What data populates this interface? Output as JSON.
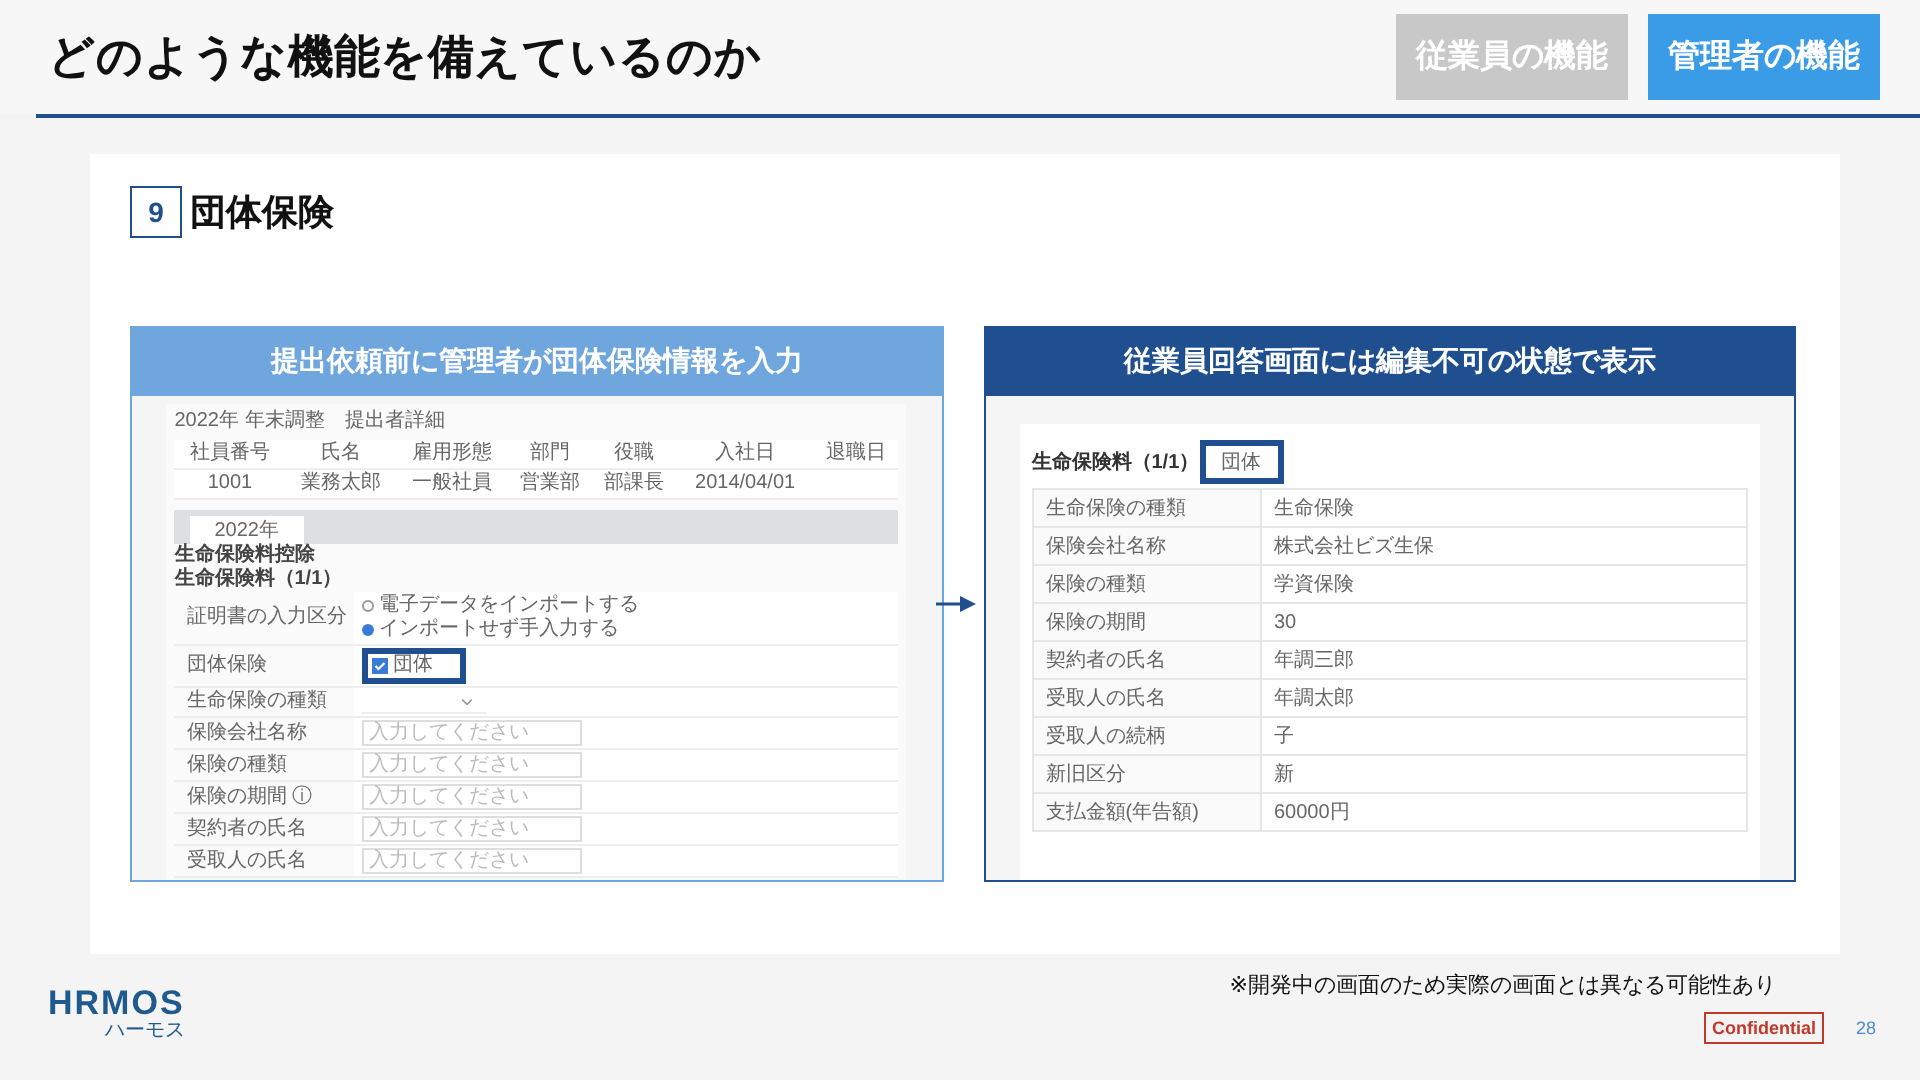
{
  "header": {
    "title": "どのような機能を備えているのか",
    "tabs": [
      {
        "label": "従業員の機能",
        "selected": false
      },
      {
        "label": "管理者の機能",
        "selected": true
      }
    ]
  },
  "section": {
    "number": "9",
    "title": "団体保険"
  },
  "panels": [
    {
      "caption": "提出依頼前に管理者が団体保険情報を入力",
      "color": "#6fa6de"
    },
    {
      "caption": "従業員回答画面には編集不可の状態で表示",
      "color": "#1f4f8f"
    }
  ],
  "admin_screen": {
    "title": "2022年 年末調整　提出者詳細",
    "columns": [
      "社員番号",
      "氏名",
      "雇用形態",
      "部門",
      "役職",
      "入社日",
      "退職日"
    ],
    "row": [
      "1001",
      "業務太郎",
      "一般社員",
      "営業部",
      "部課長",
      "2014/04/01"
    ],
    "tabs": [
      {
        "label": "2022年",
        "selected": true
      }
    ],
    "heading": "生命保険料控除",
    "subheading": "生命保険料（1/1）",
    "fields": [
      {
        "kind": "radio",
        "label": "証明書の入力区分",
        "options": [
          {
            "label": "電子データをインポートする",
            "selected": false
          },
          {
            "label": "インポートせず手入力する",
            "selected": true
          }
        ]
      },
      {
        "kind": "checkbox",
        "label": "団体保険",
        "option": {
          "label": "団体",
          "checked": true
        },
        "highlighted": true
      },
      {
        "kind": "select",
        "label": "生命保険の種類"
      },
      {
        "kind": "input",
        "label": "保険会社名称",
        "placeholder": "入力してください"
      },
      {
        "kind": "input",
        "label": "保険の種類",
        "placeholder": "入力してください"
      },
      {
        "kind": "input",
        "label": "保険の期間 ⓘ",
        "placeholder": "入力してください"
      },
      {
        "kind": "input",
        "label": "契約者の氏名",
        "placeholder": "入力してください"
      },
      {
        "kind": "input",
        "label": "受取人の氏名",
        "placeholder": "入力してください"
      }
    ]
  },
  "employee_screen": {
    "heading": "生命保険料（1/1）",
    "badge": "団体",
    "badge_highlighted": true,
    "rows": [
      {
        "label": "生命保険の種類",
        "value": "生命保険"
      },
      {
        "label": "保険会社名称",
        "value": "株式会社ビズ生保"
      },
      {
        "label": "保険の種類",
        "value": "学資保険"
      },
      {
        "label": "保険の期間",
        "value": "30"
      },
      {
        "label": "契約者の氏名",
        "value": "年調三郎"
      },
      {
        "label": "受取人の氏名",
        "value": "年調太郎"
      },
      {
        "label": "受取人の続柄",
        "value": "子"
      },
      {
        "label": "新旧区分",
        "value": "新"
      },
      {
        "label": "支払金額(年告額)",
        "value": "60000円"
      }
    ]
  },
  "footer": {
    "logo": "HRMOS",
    "logo_sub": "ハーモス",
    "note": "※開発中の画面のため実際の画面とは異なる可能性あり",
    "confidential": "Confidential",
    "page": "28"
  }
}
